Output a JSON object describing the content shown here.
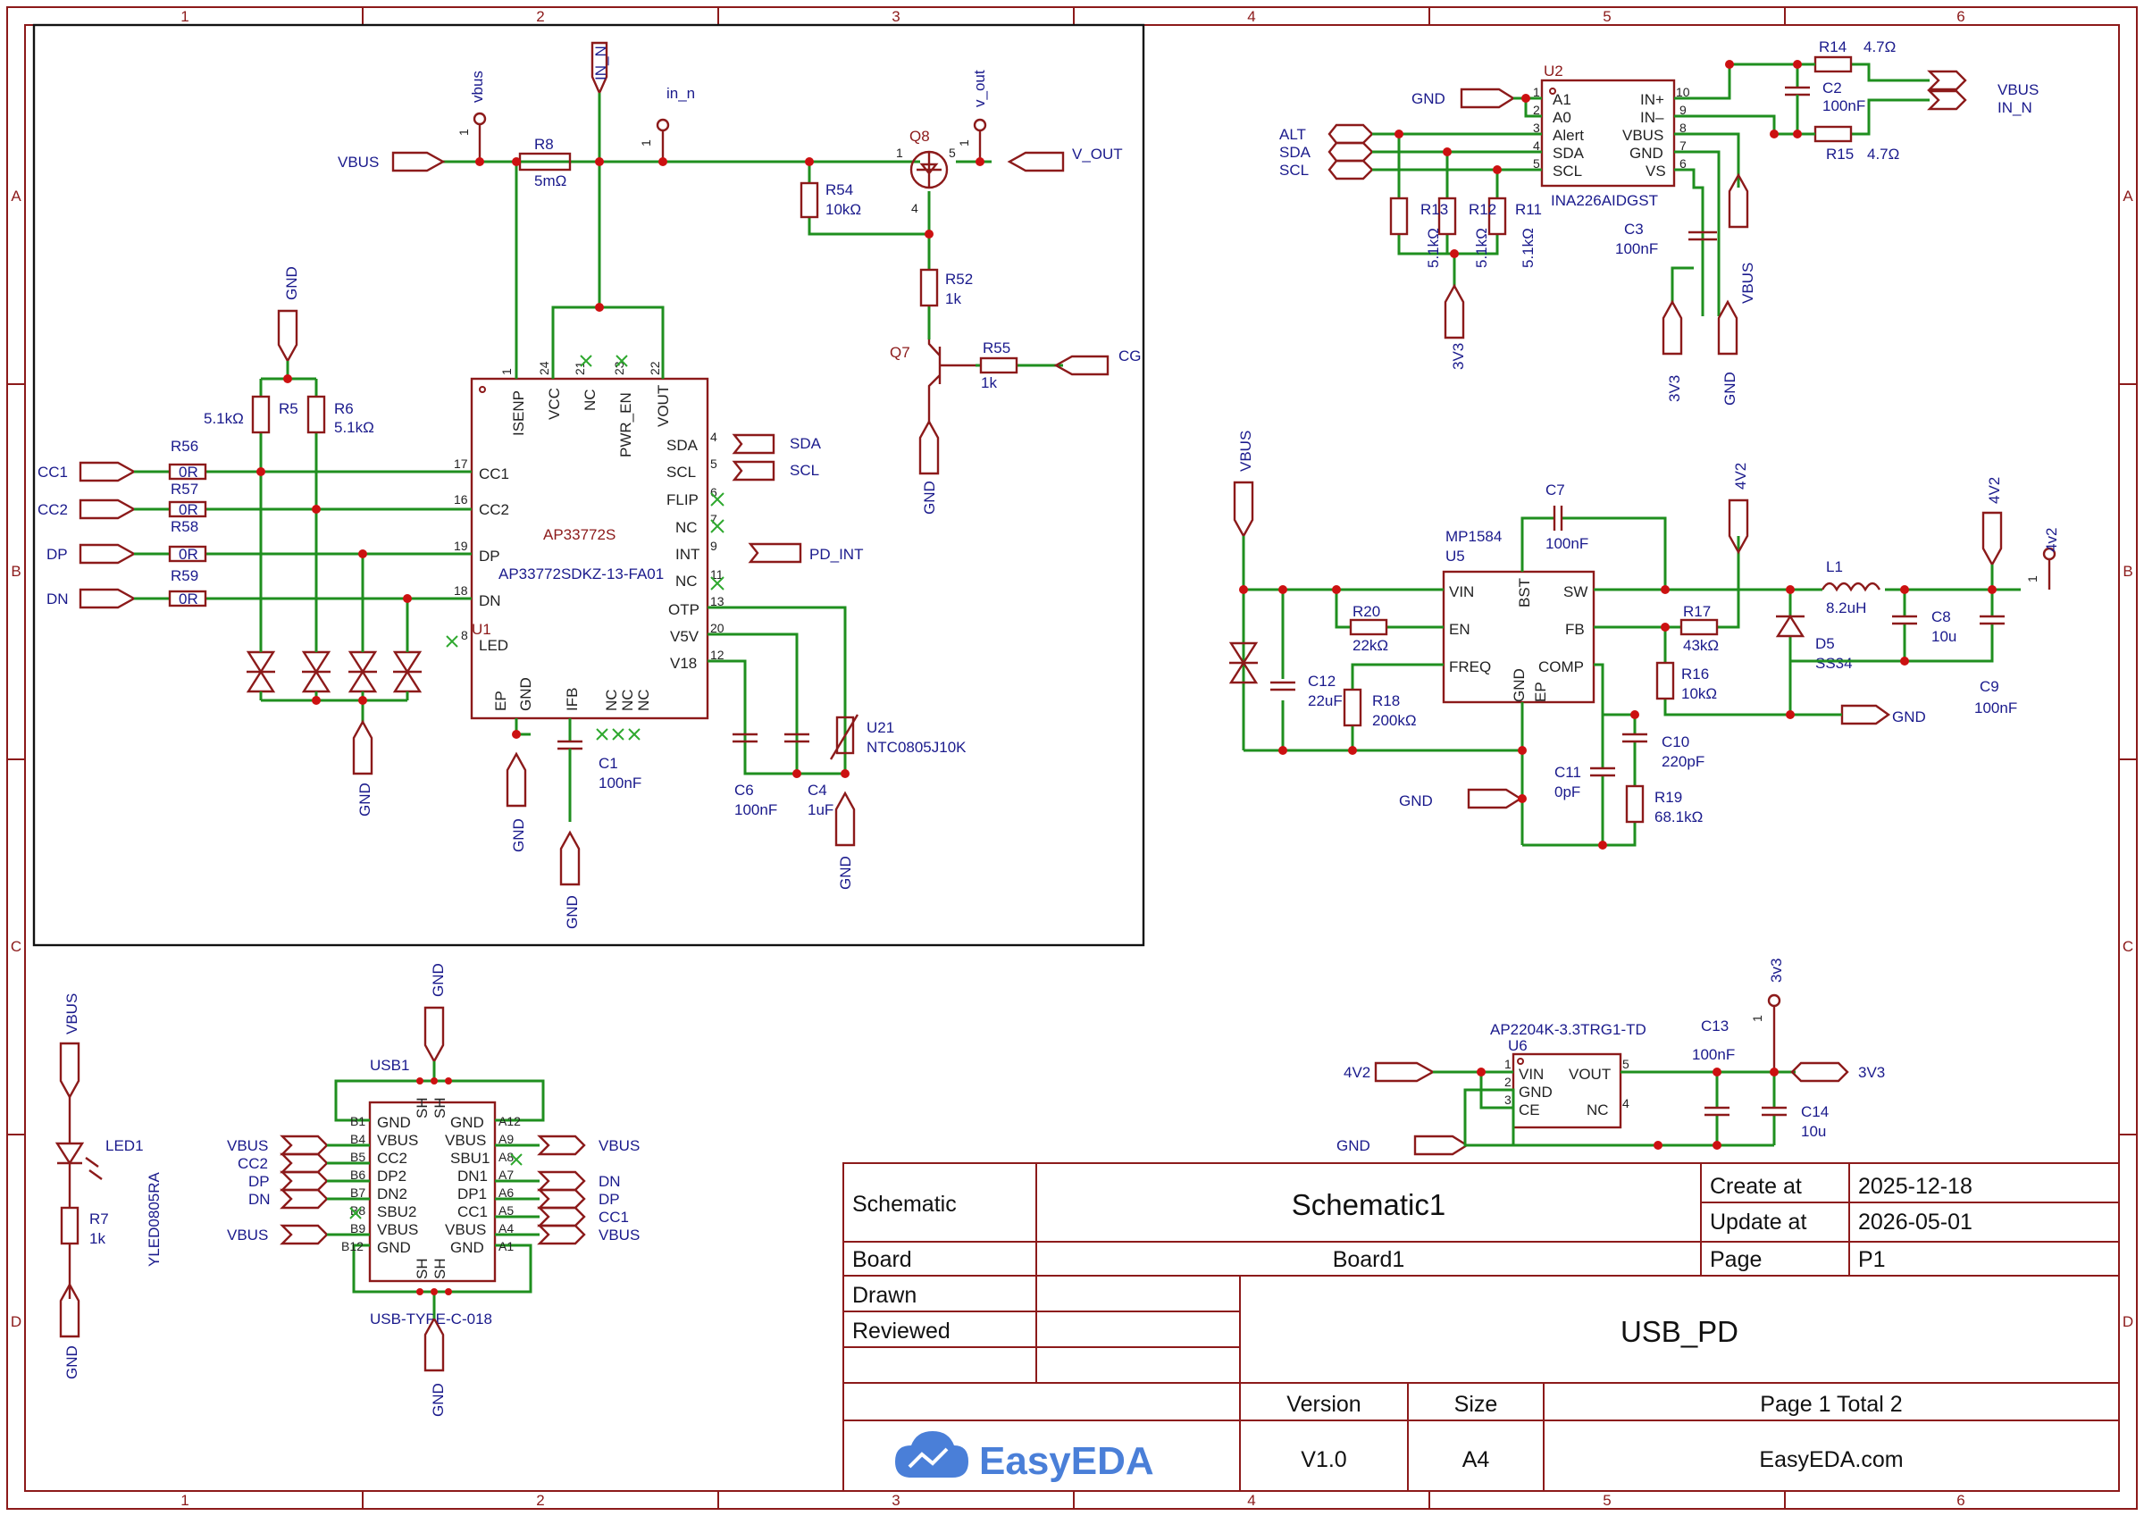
{
  "sheet_grid": {
    "columns": [
      "1",
      "2",
      "3",
      "4",
      "5",
      "6"
    ],
    "rows": [
      "A",
      "B",
      "C",
      "D"
    ]
  },
  "nets": {
    "vbus": "VBUS",
    "v_out": "V_OUT",
    "cg": "CG",
    "sda": "SDA",
    "scl": "SCL",
    "alt": "ALT",
    "pd_int": "PD_INT",
    "cc1": "CC1",
    "cc2": "CC2",
    "dp": "DP",
    "dn": "DN",
    "gnd": "GND",
    "in_n": "IN_N",
    "net_3v3": "3V3",
    "net_4v2": "4V2",
    "test_vbus": "vbus",
    "test_in_n": "in_n",
    "test_v_out": "v_out",
    "test_4v2": "4v2",
    "test_3v3": "3v3"
  },
  "components": {
    "r8": {
      "ref": "R8",
      "value": "5mΩ"
    },
    "r54": {
      "ref": "R54",
      "value": "10kΩ"
    },
    "r52": {
      "ref": "R52",
      "value": "1k"
    },
    "r55": {
      "ref": "R55",
      "value": "1k"
    },
    "q8": {
      "ref": "Q8"
    },
    "q7": {
      "ref": "Q7"
    },
    "r5": {
      "ref": "R5",
      "value": "5.1kΩ"
    },
    "r6": {
      "ref": "R6",
      "value": "5.1kΩ"
    },
    "r56": {
      "ref": "R56",
      "value": "0R"
    },
    "r57": {
      "ref": "R57",
      "value": "0R"
    },
    "r58": {
      "ref": "R58",
      "value": "0R"
    },
    "r59": {
      "ref": "R59",
      "value": "0R"
    },
    "u1": {
      "ref": "U1",
      "name": "AP33772S",
      "part": "AP33772SDKZ-13-FA01"
    },
    "c1": {
      "ref": "C1",
      "value": "100nF"
    },
    "c6": {
      "ref": "C6",
      "value": "100nF"
    },
    "c4": {
      "ref": "C4",
      "value": "1uF"
    },
    "u21": {
      "ref": "U21",
      "value": "NTC0805J10K"
    },
    "u2": {
      "ref": "U2",
      "part": "INA226AIDGST"
    },
    "r13": {
      "ref": "R13",
      "value": "5.1kΩ"
    },
    "r12": {
      "ref": "R12",
      "value": "5.1kΩ"
    },
    "r11": {
      "ref": "R11",
      "value": "5.1kΩ"
    },
    "r14": {
      "ref": "R14",
      "value": "4.7Ω"
    },
    "r15": {
      "ref": "R15",
      "value": "4.7Ω"
    },
    "c2": {
      "ref": "C2",
      "value": "100nF"
    },
    "c3": {
      "ref": "C3",
      "value": "100nF"
    },
    "u5": {
      "ref": "U5",
      "part": "MP1584"
    },
    "c7": {
      "ref": "C7",
      "value": "100nF"
    },
    "r20": {
      "ref": "R20",
      "value": "22kΩ"
    },
    "r18": {
      "ref": "R18",
      "value": "200kΩ"
    },
    "c12": {
      "ref": "C12",
      "value": "22uF"
    },
    "r17": {
      "ref": "R17",
      "value": "43kΩ"
    },
    "r16": {
      "ref": "R16",
      "value": "10kΩ"
    },
    "l1": {
      "ref": "L1",
      "value": "8.2uH"
    },
    "d5": {
      "ref": "D5",
      "value": "SS34"
    },
    "c8": {
      "ref": "C8",
      "value": "10u"
    },
    "c9": {
      "ref": "C9",
      "value": "100nF"
    },
    "c10": {
      "ref": "C10",
      "value": "220pF"
    },
    "c11": {
      "ref": "C11",
      "value": "0pF"
    },
    "r19": {
      "ref": "R19",
      "value": "68.1kΩ"
    },
    "u6": {
      "ref": "U6",
      "part": "AP2204K-3.3TRG1-TD"
    },
    "c13": {
      "ref": "C13",
      "value": "100nF"
    },
    "c14": {
      "ref": "C14",
      "value": "10u"
    },
    "led1": {
      "ref": "LED1",
      "part": "YLED0805RA"
    },
    "r7": {
      "ref": "R7",
      "value": "1k"
    },
    "usb1": {
      "ref": "USB1",
      "part": "USB-TYPE-C-018"
    }
  },
  "u1_pins": {
    "isenp": "ISENP",
    "vcc": "VCC",
    "nc": "NC",
    "pwr_en": "PWR_EN",
    "vout": "VOUT",
    "sda": "SDA",
    "scl": "SCL",
    "flip": "FLIP",
    "int": "INT",
    "otp": "OTP",
    "v5v": "V5V",
    "v18": "V18",
    "cc1": "CC1",
    "cc2": "CC2",
    "dp": "DP",
    "dn": "DN",
    "led": "LED",
    "ep": "EP",
    "gnd": "GND",
    "ifb": "IFB"
  },
  "u2_pins": {
    "a1": "A1",
    "a0": "A0",
    "alert": "Alert",
    "sda": "SDA",
    "scl": "SCL",
    "inp": "IN+",
    "inm": "IN–",
    "vbus": "VBUS",
    "gnd": "GND",
    "vs": "VS"
  },
  "u5_pins": {
    "vin": "VIN",
    "en": "EN",
    "freq": "FREQ",
    "bst": "BST",
    "sw": "SW",
    "fb": "FB",
    "comp": "COMP",
    "gnd": "GND",
    "ep": "EP"
  },
  "u6_pins": {
    "vin": "VIN",
    "gnd": "GND",
    "ce": "CE",
    "vout": "VOUT",
    "nc": "NC"
  },
  "usb_pins": {
    "gnd": "GND",
    "vbus": "VBUS",
    "cc2": "CC2",
    "dp2": "DP2",
    "dn2": "DN2",
    "sbu2": "SBU2",
    "sbu1": "SBU1",
    "dn1": "DN1",
    "dp1": "DP1",
    "cc1": "CC1",
    "sh": "SH"
  },
  "title_block": {
    "schematic_label": "Schematic",
    "schematic_name": "Schematic1",
    "create_label": "Create at",
    "create_date": "2025-12-18",
    "update_label": "Update at",
    "update_date": "2026-05-01",
    "board_label": "Board",
    "board_name": "Board1",
    "page_label": "Page",
    "page_value": "P1",
    "drawn_label": "Drawn",
    "reviewed_label": "Reviewed",
    "project_name": "USB_PD",
    "version_label": "Version",
    "version_value": "V1.0",
    "size_label": "Size",
    "size_value": "A4",
    "page_total": "Page  1  Total  2",
    "brand": "EasyEDA",
    "site": "EasyEDA.com"
  },
  "colors": {
    "frame": "#8c1a1a",
    "wire": "#1f8f1f",
    "junction": "#cc1111",
    "net_text": "#1a1a8c",
    "brand": "#4a7fd8"
  }
}
